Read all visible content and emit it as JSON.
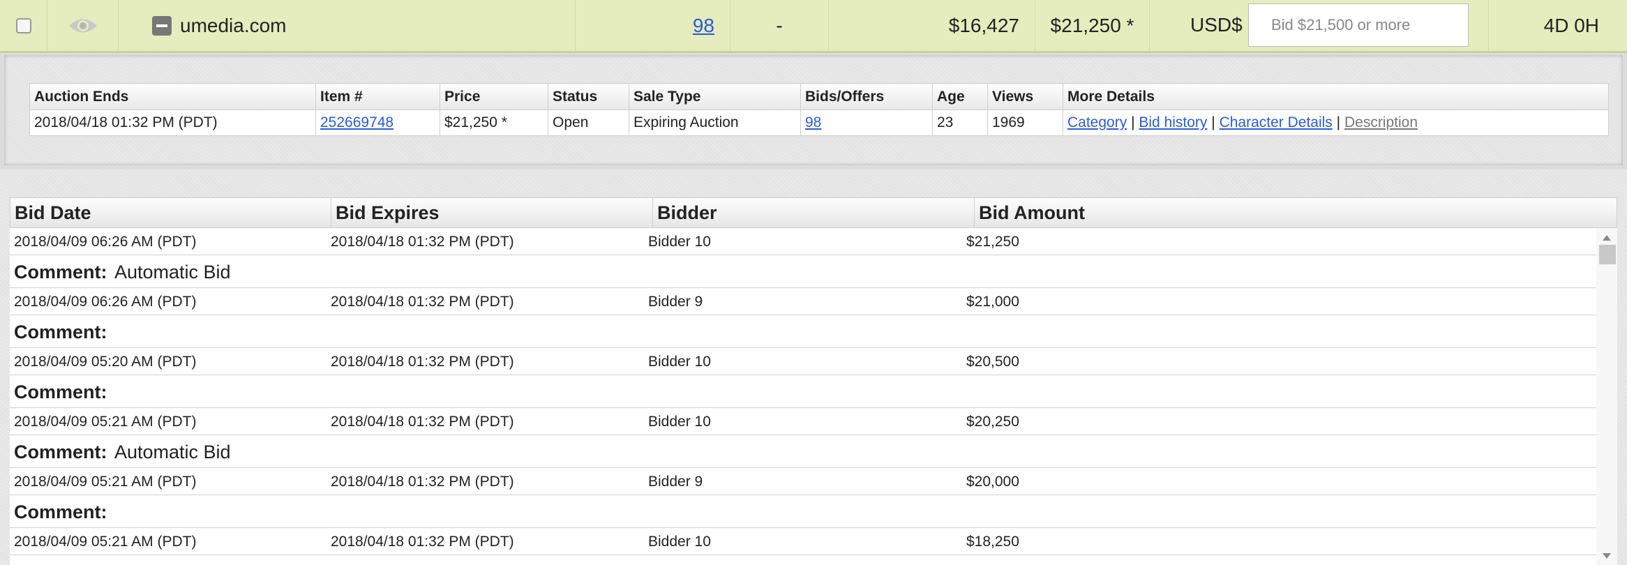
{
  "listing": {
    "domain": "umedia.com",
    "bids": "98",
    "traffic": "-",
    "valuation": "$16,427",
    "price": "$21,250 *",
    "currency": "USD$",
    "bid_placeholder": "Bid $21,500 or more",
    "time_left": "4D 0H"
  },
  "details": {
    "headers": [
      "Auction Ends",
      "Item #",
      "Price",
      "Status",
      "Sale Type",
      "Bids/Offers",
      "Age",
      "Views",
      "More Details"
    ],
    "auction_ends": "2018/04/18 01:32 PM (PDT)",
    "item_number": "252669748",
    "price": "$21,250 *",
    "status": "Open",
    "sale_type": "Expiring Auction",
    "bids_offers": "98",
    "age": "23",
    "views": "1969",
    "links": {
      "category": "Category",
      "bid_history": "Bid history",
      "character_details": "Character Details",
      "description": "Description",
      "separator": "|"
    }
  },
  "history": {
    "headers": [
      "Bid Date",
      "Bid Expires",
      "Bidder",
      "Bid Amount"
    ],
    "comment_label": "Comment:",
    "rows": [
      {
        "date": "2018/04/09 06:26 AM (PDT)",
        "expires": "2018/04/18 01:32 PM (PDT)",
        "bidder": "Bidder 10",
        "amount": "$21,250",
        "comment": "Automatic Bid"
      },
      {
        "date": "2018/04/09 06:26 AM (PDT)",
        "expires": "2018/04/18 01:32 PM (PDT)",
        "bidder": "Bidder 9",
        "amount": "$21,000",
        "comment": ""
      },
      {
        "date": "2018/04/09 05:20 AM (PDT)",
        "expires": "2018/04/18 01:32 PM (PDT)",
        "bidder": "Bidder 10",
        "amount": "$20,500",
        "comment": ""
      },
      {
        "date": "2018/04/09 05:21 AM (PDT)",
        "expires": "2018/04/18 01:32 PM (PDT)",
        "bidder": "Bidder 10",
        "amount": "$20,250",
        "comment": "Automatic Bid"
      },
      {
        "date": "2018/04/09 05:21 AM (PDT)",
        "expires": "2018/04/18 01:32 PM (PDT)",
        "bidder": "Bidder 9",
        "amount": "$20,000",
        "comment": ""
      },
      {
        "date": "2018/04/09 05:21 AM (PDT)",
        "expires": "2018/04/18 01:32 PM (PDT)",
        "bidder": "Bidder 10",
        "amount": "$18,250",
        "comment": ""
      }
    ]
  },
  "icons": {
    "watch": "eye-icon",
    "collapse": "collapse-icon",
    "scroll_up": "scroll-up-icon",
    "scroll_down": "scroll-down-icon"
  },
  "colors": {
    "row_bg": "#e5ecbd",
    "link": "#2a5bd7"
  }
}
